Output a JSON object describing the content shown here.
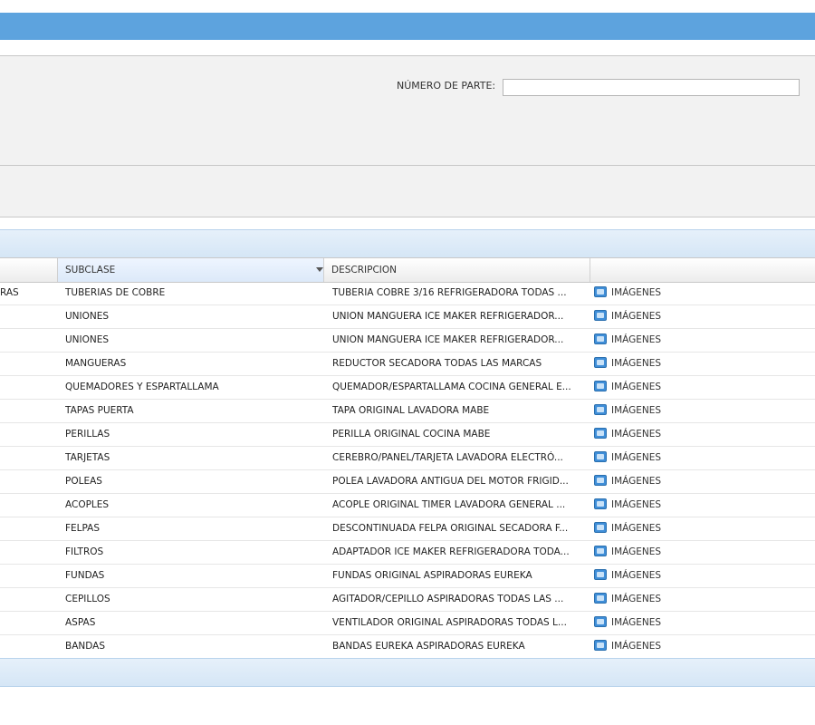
{
  "filters": {
    "part_number_label": "NÚMERO DE PARTE:",
    "part_number_value": ""
  },
  "grid": {
    "columns": {
      "subclase": "SUBCLASE",
      "descripcion": "DESCRIPCION",
      "imagenes": ""
    },
    "rows": [
      {
        "cut": "RAS",
        "subclase": "TUBERIAS DE COBRE",
        "descripcion": "TUBERIA COBRE 3/16 REFRIGERADORA TODAS ...",
        "imagenes": "IMÁGENES"
      },
      {
        "cut": "",
        "subclase": "UNIONES",
        "descripcion": "UNION MANGUERA ICE MAKER REFRIGERADOR...",
        "imagenes": "IMÁGENES"
      },
      {
        "cut": "",
        "subclase": "UNIONES",
        "descripcion": "UNION MANGUERA ICE MAKER REFRIGERADOR...",
        "imagenes": "IMÁGENES"
      },
      {
        "cut": "",
        "subclase": "MANGUERAS",
        "descripcion": "REDUCTOR SECADORA TODAS LAS MARCAS",
        "imagenes": "IMÁGENES"
      },
      {
        "cut": "",
        "subclase": "QUEMADORES Y ESPARTALLAMA",
        "descripcion": "QUEMADOR/ESPARTALLAMA COCINA GENERAL E...",
        "imagenes": "IMÁGENES"
      },
      {
        "cut": "",
        "subclase": "TAPAS PUERTA",
        "descripcion": "TAPA ORIGINAL LAVADORA MABE",
        "imagenes": "IMÁGENES"
      },
      {
        "cut": "",
        "subclase": "PERILLAS",
        "descripcion": "PERILLA ORIGINAL COCINA MABE",
        "imagenes": "IMÁGENES"
      },
      {
        "cut": "",
        "subclase": "TARJETAS",
        "descripcion": "CEREBRO/PANEL/TARJETA LAVADORA ELECTRÓ...",
        "imagenes": "IMÁGENES"
      },
      {
        "cut": "",
        "subclase": "POLEAS",
        "descripcion": "POLEA LAVADORA ANTIGUA DEL MOTOR FRIGID...",
        "imagenes": "IMÁGENES"
      },
      {
        "cut": "",
        "subclase": "ACOPLES",
        "descripcion": "ACOPLE ORIGINAL TIMER LAVADORA GENERAL ...",
        "imagenes": "IMÁGENES"
      },
      {
        "cut": "",
        "subclase": "FELPAS",
        "descripcion": "DESCONTINUADA FELPA ORIGINAL SECADORA F...",
        "imagenes": "IMÁGENES"
      },
      {
        "cut": "",
        "subclase": "FILTROS",
        "descripcion": "ADAPTADOR ICE MAKER REFRIGERADORA TODA...",
        "imagenes": "IMÁGENES"
      },
      {
        "cut": "",
        "subclase": "FUNDAS",
        "descripcion": "FUNDAS ORIGINAL ASPIRADORAS EUREKA",
        "imagenes": "IMÁGENES"
      },
      {
        "cut": "",
        "subclase": "CEPILLOS",
        "descripcion": "AGITADOR/CEPILLO ASPIRADORAS TODAS LAS ...",
        "imagenes": "IMÁGENES"
      },
      {
        "cut": "",
        "subclase": "ASPAS",
        "descripcion": "VENTILADOR ORIGINAL ASPIRADORAS TODAS L...",
        "imagenes": "IMÁGENES"
      },
      {
        "cut": "",
        "subclase": "BANDAS",
        "descripcion": "BANDAS EUREKA ASPIRADORAS EUREKA",
        "imagenes": "IMÁGENES"
      }
    ]
  }
}
